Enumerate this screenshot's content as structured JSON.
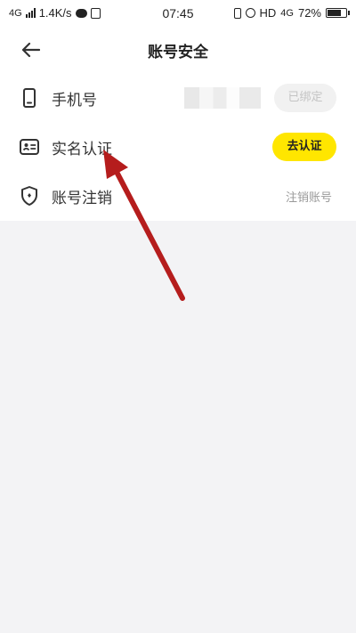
{
  "status_bar": {
    "network": "4G",
    "speed": "1.4K/s",
    "time": "07:45",
    "hd": "HD",
    "network_right": "4G",
    "battery": "72%"
  },
  "header": {
    "title": "账号安全"
  },
  "rows": [
    {
      "label": "手机号",
      "action": "已绑定",
      "icon": "phone-icon"
    },
    {
      "label": "实名认证",
      "action": "去认证",
      "icon": "id-card-icon"
    },
    {
      "label": "账号注销",
      "action": "注销账号",
      "icon": "shield-icon"
    }
  ],
  "colors": {
    "accent": "#ffe600",
    "annotation_arrow": "#b51d1d"
  }
}
